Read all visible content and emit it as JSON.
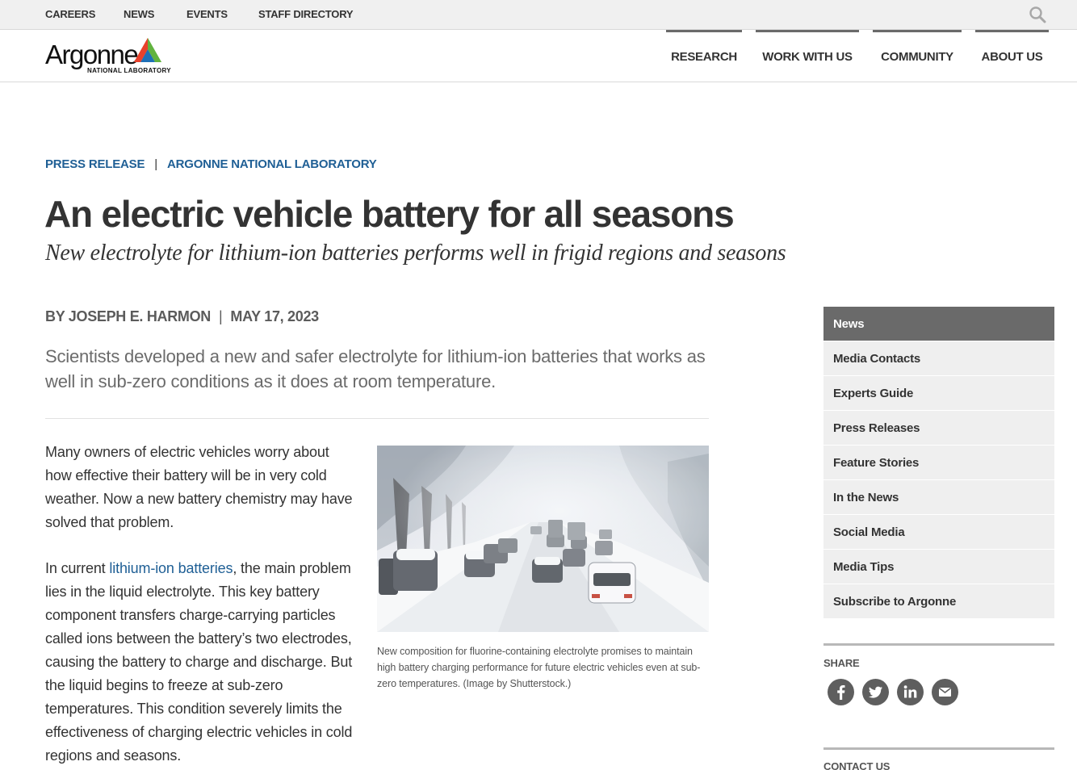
{
  "utility_nav": {
    "careers": "CAREERS",
    "news": "NEWS",
    "events": "EVENTS",
    "staff_directory": "STAFF DIRECTORY"
  },
  "logo": {
    "wordmark": "Argonne",
    "subtitle": "NATIONAL LABORATORY"
  },
  "main_nav": [
    "RESEARCH",
    "WORK WITH US",
    "COMMUNITY",
    "ABOUT US"
  ],
  "article": {
    "kicker_type": "PRESS RELEASE",
    "kicker_sep": "|",
    "kicker_source": "ARGONNE NATIONAL LABORATORY",
    "title": "An electric vehicle battery for all seasons",
    "subtitle": "New electrolyte for lithium-ion batteries performs well in frigid regions and seasons",
    "byline": "BY JOSEPH E. HARMON",
    "byline_sep": "|",
    "date": "MAY 17, 2023",
    "lede": "Scientists developed a new and safer electrolyte for lithium-ion batteries that works as well in sub-zero conditions as it does at room temperature.",
    "para1": "Many owners of electric vehicles worry about how effective their battery will be in very cold weather. Now a new battery chemistry may have solved that problem.",
    "para2_prefix": "In current ",
    "para2_link": "lithium-ion batteries",
    "para2_rest": ", the main problem lies in the liquid electrolyte. This key battery component transfers charge-carrying particles called ions between the battery’s two electrodes, causing the battery to charge and discharge. But the liquid begins to freeze at sub-zero temperatures. This condition severely limits the effectiveness of charging electric vehicles in cold regions and seasons.",
    "caption": "New composition for fluorine-containing electrolyte promises to maintain high battery charging performance for future electric vehicles even at sub-zero temperatures. (Image by Shutterstock.)"
  },
  "sidebar": {
    "items": [
      {
        "label": "News",
        "active": true
      },
      {
        "label": "Media Contacts"
      },
      {
        "label": "Experts Guide"
      },
      {
        "label": "Press Releases"
      },
      {
        "label": "Feature Stories"
      },
      {
        "label": "In the News"
      },
      {
        "label": "Social Media"
      },
      {
        "label": "Media Tips"
      },
      {
        "label": "Subscribe to Argonne"
      }
    ],
    "share_label": "SHARE",
    "share_icons": [
      "facebook-icon",
      "twitter-icon",
      "linkedin-icon",
      "email-icon"
    ],
    "contact_label": "CONTACT US"
  },
  "colors": {
    "link": "#1f5f95",
    "active_sidebar": "#6a6a6a",
    "utility_bg": "#f0f0f0"
  }
}
